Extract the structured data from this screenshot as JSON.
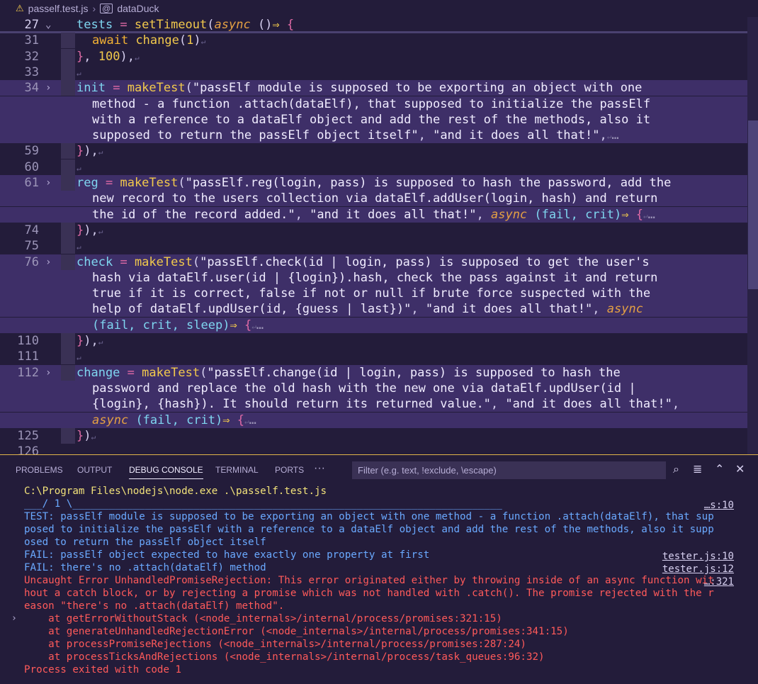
{
  "breadcrumb": {
    "file": "pasself.test.js",
    "symbol": "dataDuck"
  },
  "editor": {
    "sticky": {
      "ln": "27",
      "code": [
        "tests",
        " = ",
        "setTimeout",
        "(",
        "async",
        " ()",
        "⇒",
        " {"
      ]
    },
    "lines": [
      {
        "ln": "31",
        "t": "await change(1)"
      },
      {
        "ln": "32",
        "t": "}, 100),"
      },
      {
        "ln": "33",
        "t": ""
      },
      {
        "ln": "34",
        "t1": "init = makeTest(\"passElf module is supposed to be exporting an object with one",
        "t2": "method - a function .attach(dataElf), that supposed to initialize the passElf",
        "t3": "with a reference to a dataElf object and add the rest of the methods, also it",
        "t4": "supposed to return the passElf object itself\", \"and it does all that!\",",
        "ell": "…"
      },
      {
        "ln": "59",
        "t": "}),"
      },
      {
        "ln": "60",
        "t": ""
      },
      {
        "ln": "61",
        "t1": "reg = makeTest(\"passElf.reg(login, pass) is supposed to hash the password, add the",
        "t2": "new record to the users collection via dataElf.addUser(login, hash) and return",
        "t3": "the id of the record added.\", \"and it does all that!\",",
        "async": "async",
        "params": "(fail, crit)",
        "ell": "…"
      },
      {
        "ln": "74",
        "t": "}),"
      },
      {
        "ln": "75",
        "t": ""
      },
      {
        "ln": "76",
        "t1": "check = makeTest(\"passElf.check(id | login, pass) is supposed to get the user's",
        "t2": "hash via dataElf.user(id | {login}).hash, check the pass against it and return",
        "t3": "true if it is correct, false if not or null if brute force suspected with the",
        "t4": "help of dataElf.updUser(id, {guess | last})\", \"and it does all that!\",",
        "async": "async",
        "params": "(fail, crit, sleep)",
        "ell": "…"
      },
      {
        "ln": "110",
        "t": "}),"
      },
      {
        "ln": "111",
        "t": ""
      },
      {
        "ln": "112",
        "t1": "change = makeTest(\"passElf.change(id | login, pass) is supposed to hash the",
        "t2": "password and replace the old hash with the new one via dataElf.updUser(id |",
        "t3": "{login}, {hash}). It should return its returned value.\", \"and it does all that!\",",
        "async": "async",
        "params": "(fail, crit)",
        "ell": "…"
      },
      {
        "ln": "125",
        "t": "})"
      },
      {
        "ln": "126",
        "t": ""
      }
    ]
  },
  "panel": {
    "tabs": [
      "PROBLEMS",
      "OUTPUT",
      "DEBUG CONSOLE",
      "TERMINAL",
      "PORTS"
    ],
    "active_tab": "DEBUG CONSOLE",
    "filter_placeholder": "Filter (e.g. text, !exclude, \\escape)",
    "console": [
      {
        "cls": "c-yellow",
        "text": "C:\\Program Files\\nodejs\\node.exe .\\pasself.test.js"
      },
      {
        "cls": "c-blue",
        "text": "___/ 1 \\_______________________________________________________________________",
        "link": "…s:10"
      },
      {
        "cls": "c-blue",
        "text": "TEST: passElf module is supposed to be exporting an object with one method - a function .attach(dataElf), that sup"
      },
      {
        "cls": "c-blue",
        "text": "posed to initialize the passElf with a reference to a dataElf object and add the rest of the methods, also it supp"
      },
      {
        "cls": "c-blue",
        "text": "osed to return the passElf object itself"
      },
      {
        "cls": "c-blue",
        "text": "FAIL: passElf object expected to have exactly one property at first",
        "link": "tester.js:10"
      },
      {
        "cls": "c-blue",
        "text": "FAIL: there's no .attach(dataElf) method",
        "link": "tester.js:12"
      },
      {
        "cls": "c-red",
        "text": "Uncaught Error UnhandledPromiseRejection: This error originated either by throwing inside of an async function wit",
        "link": "…:321"
      },
      {
        "cls": "c-red",
        "text": "hout a catch block, or by rejecting a promise which was not handled with .catch(). The promise rejected with the r"
      },
      {
        "cls": "c-red",
        "text": "eason \"there's no .attach(dataElf) method\"."
      },
      {
        "cls": "c-red",
        "text": "    at getErrorWithoutStack (<node_internals>/internal/process/promises:321:15)",
        "expand": true
      },
      {
        "cls": "c-red",
        "text": "    at generateUnhandledRejectionError (<node_internals>/internal/process/promises:341:15)"
      },
      {
        "cls": "c-red",
        "text": "    at processPromiseRejections (<node_internals>/internal/process/promises:287:24)"
      },
      {
        "cls": "c-red",
        "text": "    at processTicksAndRejections (<node_internals>/internal/process/task_queues:96:32)"
      },
      {
        "cls": "c-red",
        "text": "Process exited with code 1"
      }
    ]
  }
}
